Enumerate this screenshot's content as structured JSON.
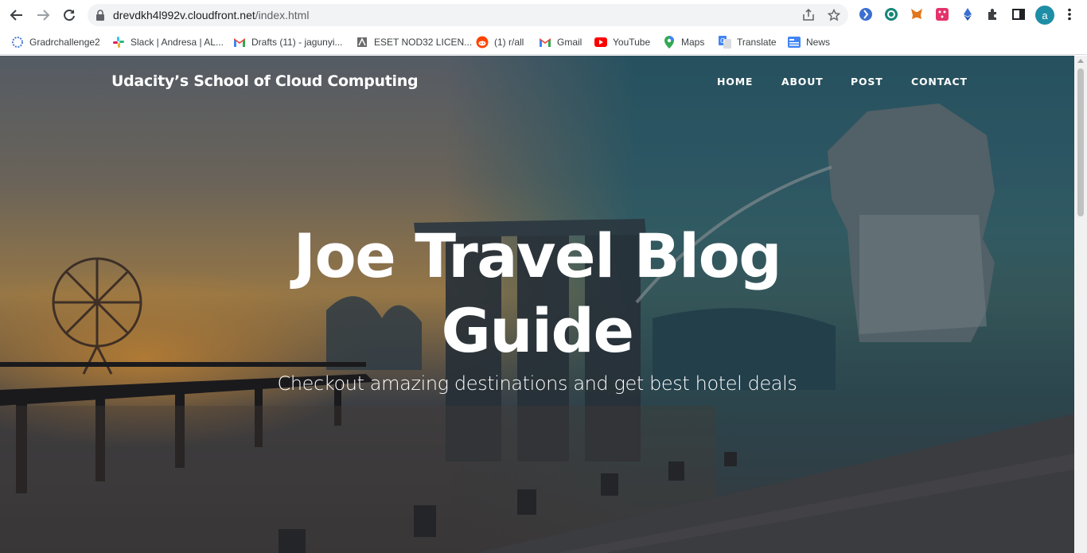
{
  "browser": {
    "url_host": "drevdkh4l992v.cloudfront.net",
    "url_path": "/index.html",
    "profile_initial": "a",
    "bookmarks": [
      {
        "label": "Gradrchallenge2",
        "icon": "gear-blue-icon"
      },
      {
        "label": "Slack | Andresa | AL...",
        "icon": "slack-icon"
      },
      {
        "label": "Drafts (11) - jagunyi...",
        "icon": "gmail-icon"
      },
      {
        "label": "ESET NOD32 LICEN...",
        "icon": "eset-icon"
      },
      {
        "label": "(1) r/all",
        "icon": "reddit-icon"
      },
      {
        "label": "Gmail",
        "icon": "gmail-icon"
      },
      {
        "label": "YouTube",
        "icon": "youtube-icon"
      },
      {
        "label": "Maps",
        "icon": "maps-icon"
      },
      {
        "label": "Translate",
        "icon": "translate-icon"
      },
      {
        "label": "News",
        "icon": "news-icon"
      }
    ]
  },
  "site": {
    "brand": "Udacity’s School of Cloud Computing",
    "nav": [
      "HOME",
      "ABOUT",
      "POST",
      "CONTACT"
    ],
    "hero": {
      "title_line1": "Joe Travel Blog",
      "title_line2": "Guide",
      "subtitle": "Checkout amazing destinations and get best hotel deals"
    }
  },
  "colors": {
    "accent_teal": "#1e8ea6",
    "sky_orange": "#c79c58"
  }
}
